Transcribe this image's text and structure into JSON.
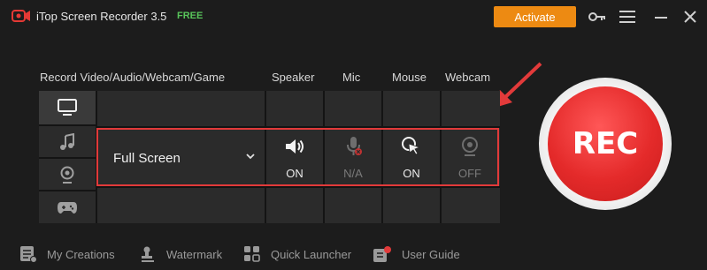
{
  "titlebar": {
    "app_title": "iTop Screen Recorder 3.5",
    "edition_badge": "FREE",
    "activate_label": "Activate",
    "icons": [
      "key-icon",
      "menu-icon",
      "minimize-icon",
      "close-icon"
    ]
  },
  "headers": {
    "mode_label": "Record Video/Audio/Webcam/Game",
    "speaker": "Speaker",
    "mic": "Mic",
    "mouse": "Mouse",
    "webcam": "Webcam"
  },
  "modes": [
    "monitor-icon",
    "music-icon",
    "webcam-icon",
    "gamepad-icon"
  ],
  "area": {
    "selected": "Full Screen"
  },
  "devices": {
    "speaker": "ON",
    "mic": "N/A",
    "mouse": "ON",
    "webcam": "OFF"
  },
  "rec_label": "REC",
  "footer": {
    "my_creations": "My Creations",
    "watermark": "Watermark",
    "quick_launcher": "Quick Launcher",
    "user_guide": "User Guide"
  },
  "colors": {
    "accent_orange": "#ed8a12",
    "rec_red": "#e42a2a",
    "highlight_red": "#e23a3a",
    "free_green": "#58c45a"
  }
}
